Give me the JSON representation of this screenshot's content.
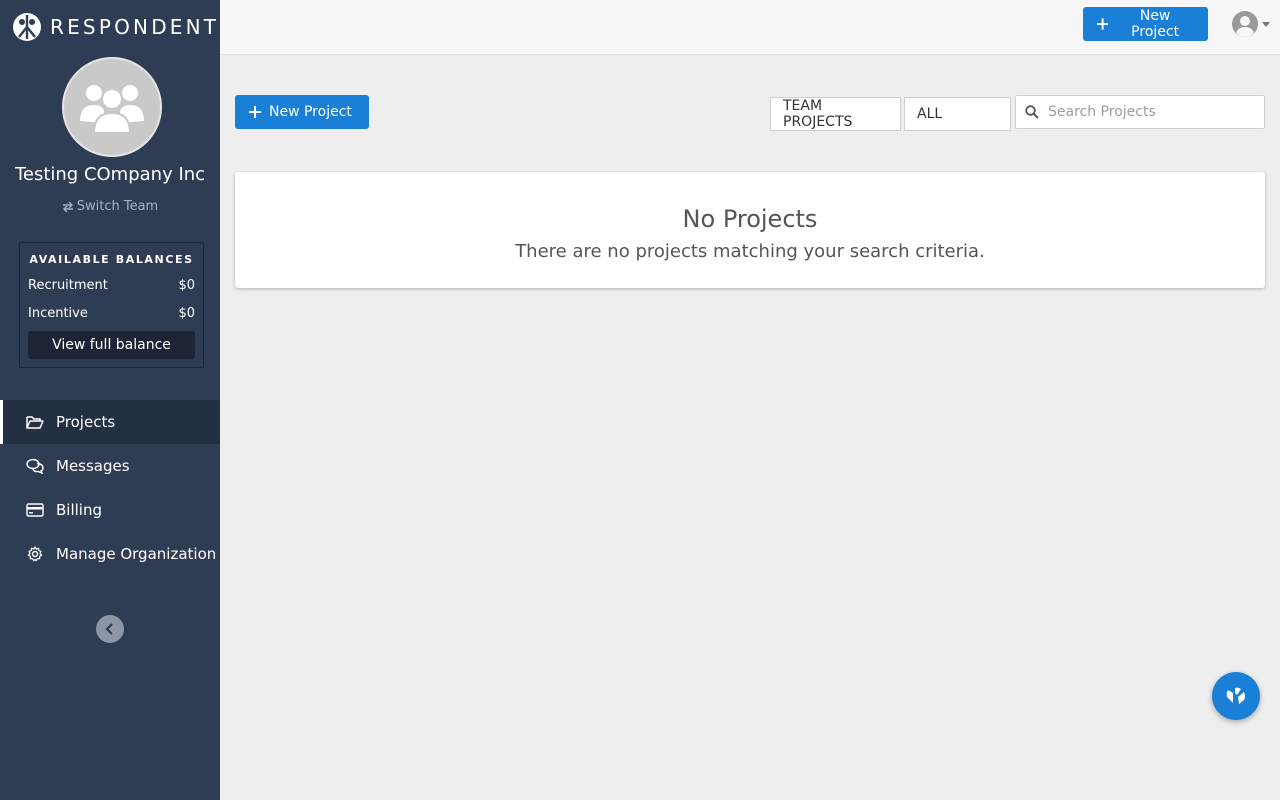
{
  "brand": {
    "name": "RESPONDENT",
    "logo_icon": "respondent-logo-icon"
  },
  "team": {
    "name": "Testing COmpany Inc",
    "switch_label": "Switch Team",
    "avatar_icon": "group-icon"
  },
  "balances": {
    "title": "AVAILABLE BALANCES",
    "rows": [
      {
        "label": "Recruitment",
        "value": "$0"
      },
      {
        "label": "Incentive",
        "value": "$0"
      }
    ],
    "view_button": "View full balance"
  },
  "nav": {
    "items": [
      {
        "label": "Projects",
        "icon": "folder-open-icon",
        "active": true
      },
      {
        "label": "Messages",
        "icon": "chat-icon",
        "active": false
      },
      {
        "label": "Billing",
        "icon": "credit-card-icon",
        "active": false
      },
      {
        "label": "Manage Organization",
        "icon": "gear-icon",
        "active": false
      }
    ]
  },
  "topbar": {
    "new_project_label": "New Project",
    "user_icon": "user-circle-icon"
  },
  "toolbar": {
    "new_project_label": "New Project",
    "team_filter": "TEAM PROJECTS",
    "status_filter": "ALL",
    "search_placeholder": "Search Projects",
    "search_value": ""
  },
  "empty_state": {
    "title": "No Projects",
    "message": "There are no projects matching your search criteria."
  },
  "colors": {
    "sidebar_bg": "#2f3d54",
    "primary": "#1a7fd6",
    "page_bg": "#eeeeee"
  }
}
